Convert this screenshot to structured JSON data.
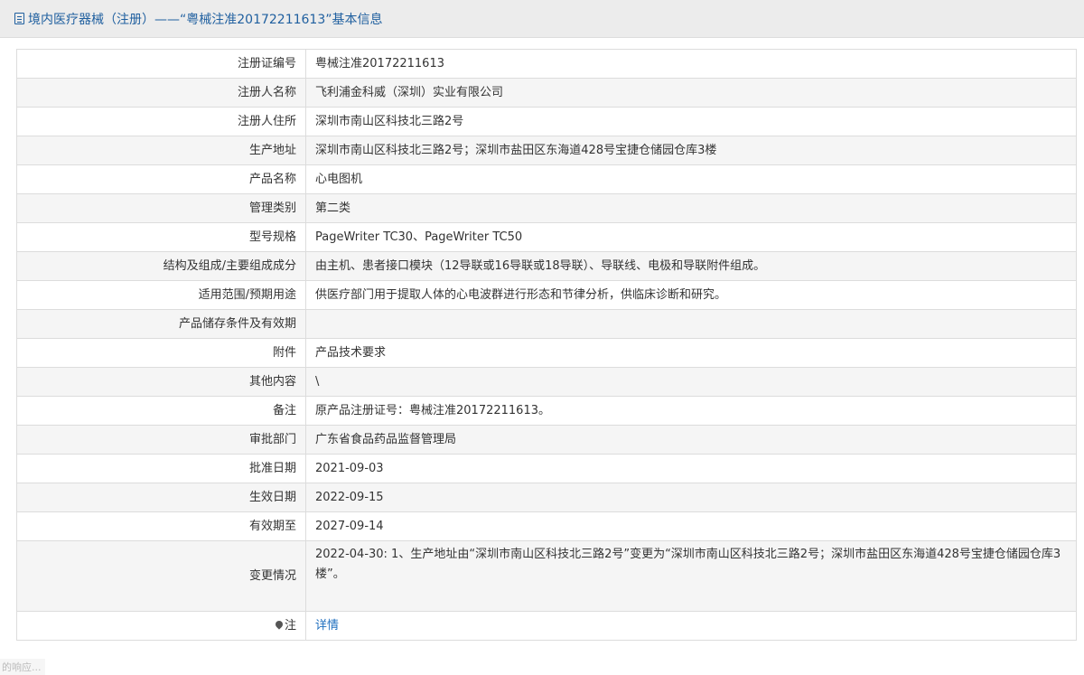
{
  "header": {
    "title": "境内医疗器械（注册）——“粤械注准20172211613”基本信息"
  },
  "rows": [
    {
      "label": "注册证编号",
      "value": "粤械注准20172211613"
    },
    {
      "label": "注册人名称",
      "value": "飞利浦金科威（深圳）实业有限公司"
    },
    {
      "label": "注册人住所",
      "value": "深圳市南山区科技北三路2号"
    },
    {
      "label": "生产地址",
      "value": "深圳市南山区科技北三路2号；深圳市盐田区东海道428号宝捷仓储园仓库3楼"
    },
    {
      "label": "产品名称",
      "value": "心电图机"
    },
    {
      "label": "管理类别",
      "value": "第二类"
    },
    {
      "label": "型号规格",
      "value": "PageWriter TC30、PageWriter TC50"
    },
    {
      "label": "结构及组成/主要组成成分",
      "value": "由主机、患者接口模块（12导联或16导联或18导联）、导联线、电极和导联附件组成。"
    },
    {
      "label": "适用范围/预期用途",
      "value": "供医疗部门用于提取人体的心电波群进行形态和节律分析，供临床诊断和研究。"
    },
    {
      "label": "产品储存条件及有效期",
      "value": ""
    },
    {
      "label": "附件",
      "value": "产品技术要求"
    },
    {
      "label": "其他内容",
      "value": "\\"
    },
    {
      "label": "备注",
      "value": "原产品注册证号：粤械注准20172211613。"
    },
    {
      "label": "审批部门",
      "value": "广东省食品药品监督管理局"
    },
    {
      "label": "批准日期",
      "value": "2021-09-03"
    },
    {
      "label": "生效日期",
      "value": "2022-09-15"
    },
    {
      "label": "有效期至",
      "value": "2027-09-14"
    },
    {
      "label": "变更情况",
      "value": "2022-04-30: 1、生产地址由“深圳市南山区科技北三路2号”变更为“深圳市南山区科技北三路2号；深圳市盐田区东海道428号宝捷仓储园仓库3楼”。"
    }
  ],
  "note_row": {
    "label": "注",
    "link_text": "详情"
  },
  "status_overlay": "的响应..."
}
